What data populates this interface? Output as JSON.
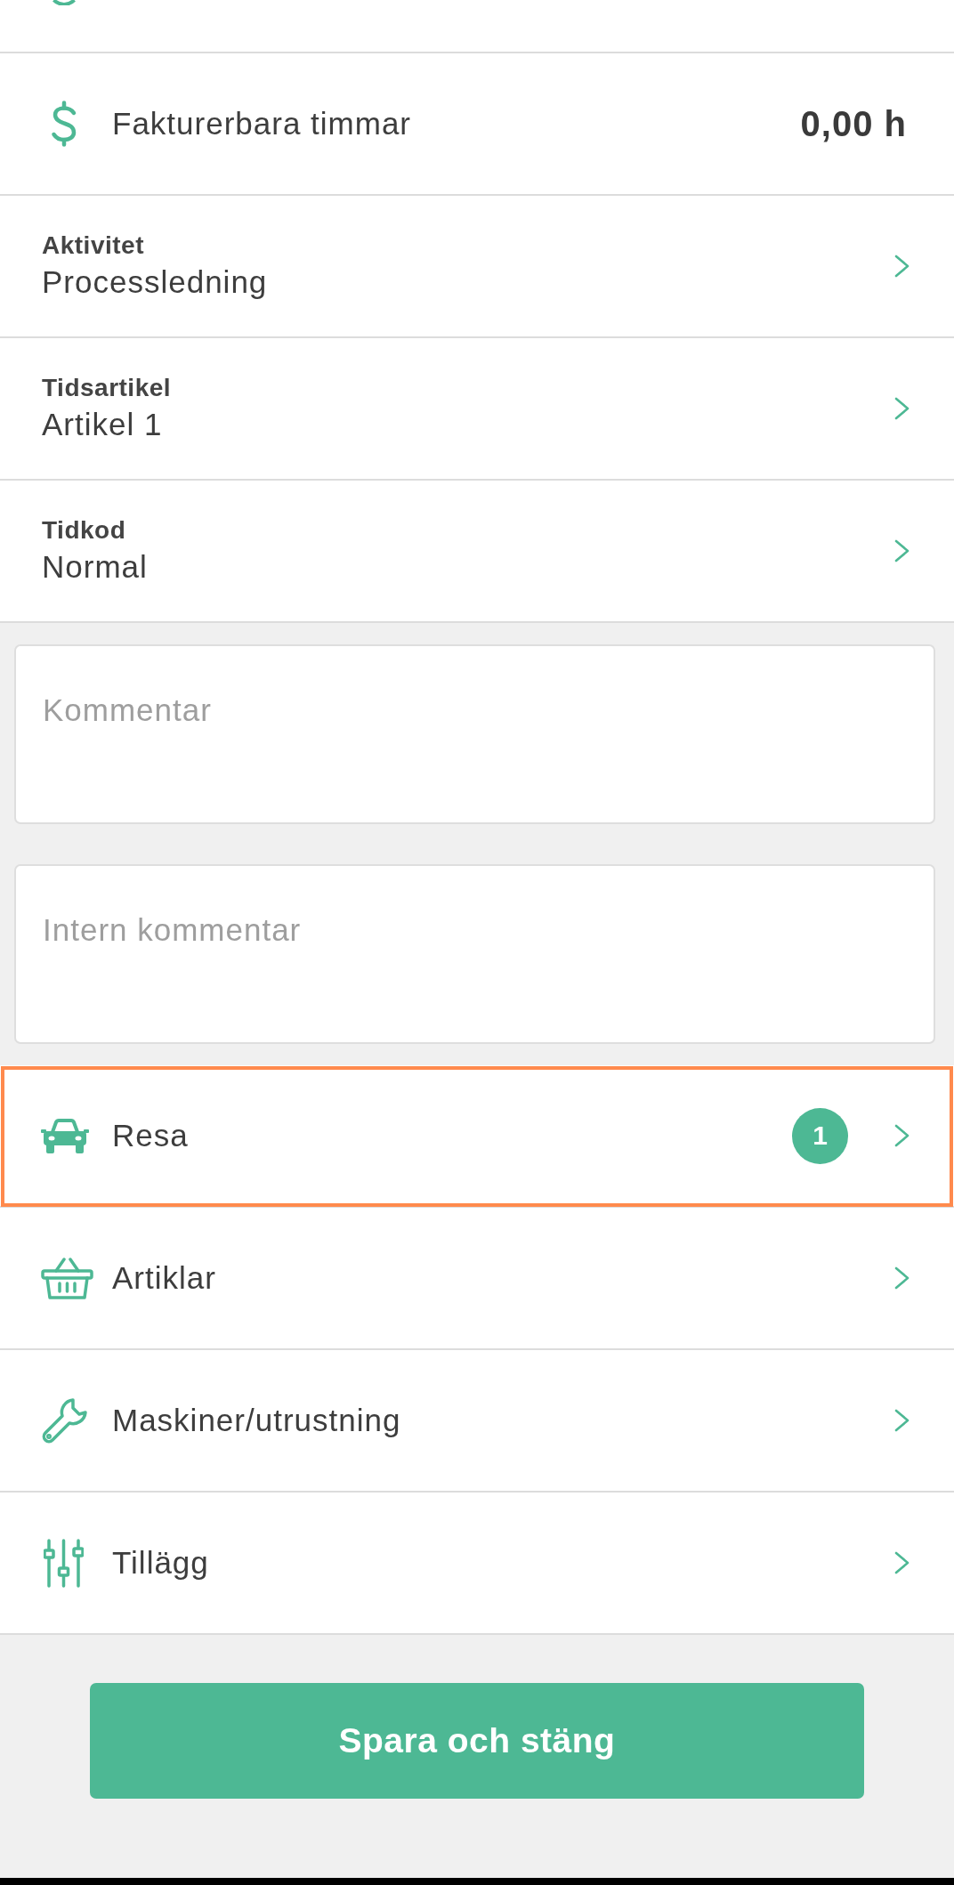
{
  "hours": {
    "label": "Fakturerbara timmar",
    "value": "0,00 h"
  },
  "fields": [
    {
      "label": "Aktivitet",
      "value": "Processledning"
    },
    {
      "label": "Tidsartikel",
      "value": "Artikel 1"
    },
    {
      "label": "Tidkod",
      "value": "Normal"
    }
  ],
  "comments": [
    {
      "placeholder": "Kommentar"
    },
    {
      "placeholder": "Intern kommentar"
    }
  ],
  "sections": [
    {
      "label": "Resa",
      "count": "1",
      "highlighted": true
    },
    {
      "label": "Artiklar",
      "highlighted": false
    },
    {
      "label": "Maskiner/utrustning",
      "highlighted": false
    },
    {
      "label": "Tillägg",
      "highlighted": false
    }
  ],
  "save_button": {
    "label": "Spara och stäng"
  }
}
